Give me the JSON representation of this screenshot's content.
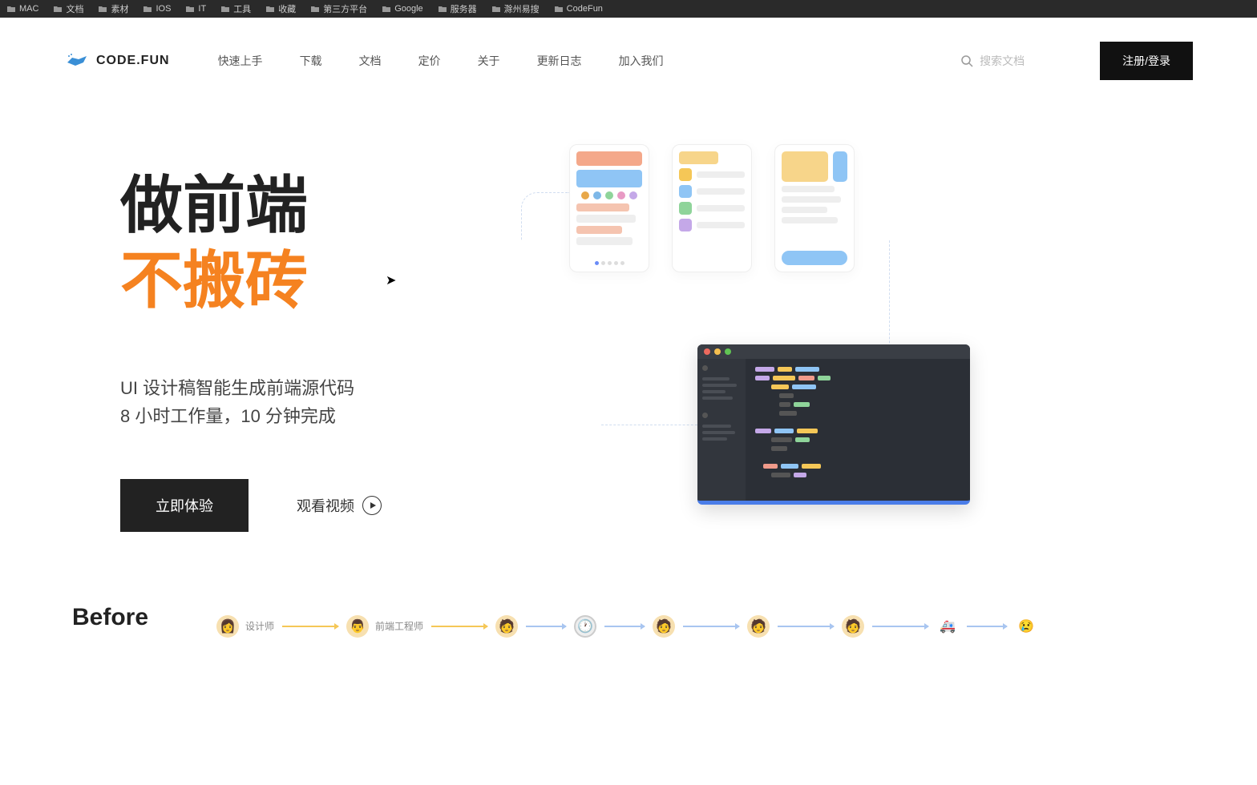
{
  "bookmarks": [
    {
      "label": "MAC"
    },
    {
      "label": "文档"
    },
    {
      "label": "素材"
    },
    {
      "label": "IOS"
    },
    {
      "label": "IT"
    },
    {
      "label": "工具"
    },
    {
      "label": "收藏"
    },
    {
      "label": "第三方平台"
    },
    {
      "label": "Google"
    },
    {
      "label": "服务器"
    },
    {
      "label": "滁州易搜"
    },
    {
      "label": "CodeFun"
    }
  ],
  "logo": {
    "text": "CODE.FUN"
  },
  "nav": [
    {
      "label": "快速上手"
    },
    {
      "label": "下载"
    },
    {
      "label": "文档"
    },
    {
      "label": "定价"
    },
    {
      "label": "关于"
    },
    {
      "label": "更新日志"
    },
    {
      "label": "加入我们"
    }
  ],
  "search": {
    "placeholder": "搜索文档"
  },
  "signup": {
    "label": "注册/登录"
  },
  "hero": {
    "title1": "做前端",
    "title2": "不搬砖",
    "sub1": "UI 设计稿智能生成前端源代码",
    "sub2": "8 小时工作量，10 分钟完成",
    "cta": "立即体验",
    "watch": "观看视频"
  },
  "before": {
    "title": "Before",
    "steps": [
      {
        "avatar": "👩",
        "label": "设计师"
      },
      {
        "avatar": "👨",
        "label": "前端工程师"
      },
      {
        "avatar": "🧑",
        "label": ""
      },
      {
        "avatar": "🕐",
        "label": ""
      },
      {
        "avatar": "🧑",
        "label": ""
      },
      {
        "avatar": "🧑",
        "label": ""
      },
      {
        "avatar": "🧑",
        "label": ""
      },
      {
        "avatar": "🚑",
        "label": ""
      },
      {
        "avatar": "😢",
        "label": ""
      }
    ]
  }
}
